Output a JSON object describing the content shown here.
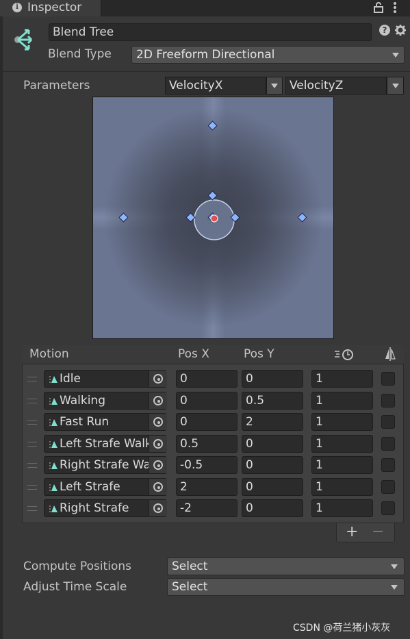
{
  "tab": {
    "label": "Inspector",
    "info_glyph": "i"
  },
  "header": {
    "name_value": "Blend Tree",
    "blend_type_label": "Blend Type",
    "blend_type_value": "2D Freeform Directional",
    "help_glyph": "?"
  },
  "parameters": {
    "label": "Parameters",
    "x_param": "VelocityX",
    "y_param": "VelocityZ"
  },
  "table": {
    "col_motion": "Motion",
    "col_posx": "Pos X",
    "col_posy": "Pos Y",
    "rows": [
      {
        "name": "Idle",
        "posx": "0",
        "posy": "0",
        "speed": "1"
      },
      {
        "name": "Walking",
        "posx": "0",
        "posy": "0.5",
        "speed": "1"
      },
      {
        "name": "Fast Run",
        "posx": "0",
        "posy": "2",
        "speed": "1"
      },
      {
        "name": "Left Strafe Walk",
        "posx": "0.5",
        "posy": "0",
        "speed": "1"
      },
      {
        "name": "Right Strafe Walk",
        "posx": "-0.5",
        "posy": "0",
        "speed": "1"
      },
      {
        "name": "Left Strafe",
        "posx": "2",
        "posy": "0",
        "speed": "1"
      },
      {
        "name": "Right Strafe",
        "posx": "-2",
        "posy": "0",
        "speed": "1"
      }
    ],
    "add_glyph": "+",
    "remove_glyph": "−"
  },
  "compute": {
    "label": "Compute Positions",
    "value": "Select"
  },
  "adjust": {
    "label": "Adjust Time Scale",
    "value": "Select"
  },
  "watermark": "CSDN @荷兰猪小灰灰",
  "colors": {
    "panel_bg": "#383838",
    "graph_bg": "#6a7591",
    "node_fill": "#8fb4ff",
    "current_point": "#e05050",
    "icon_accent": "#7fe0d0"
  }
}
